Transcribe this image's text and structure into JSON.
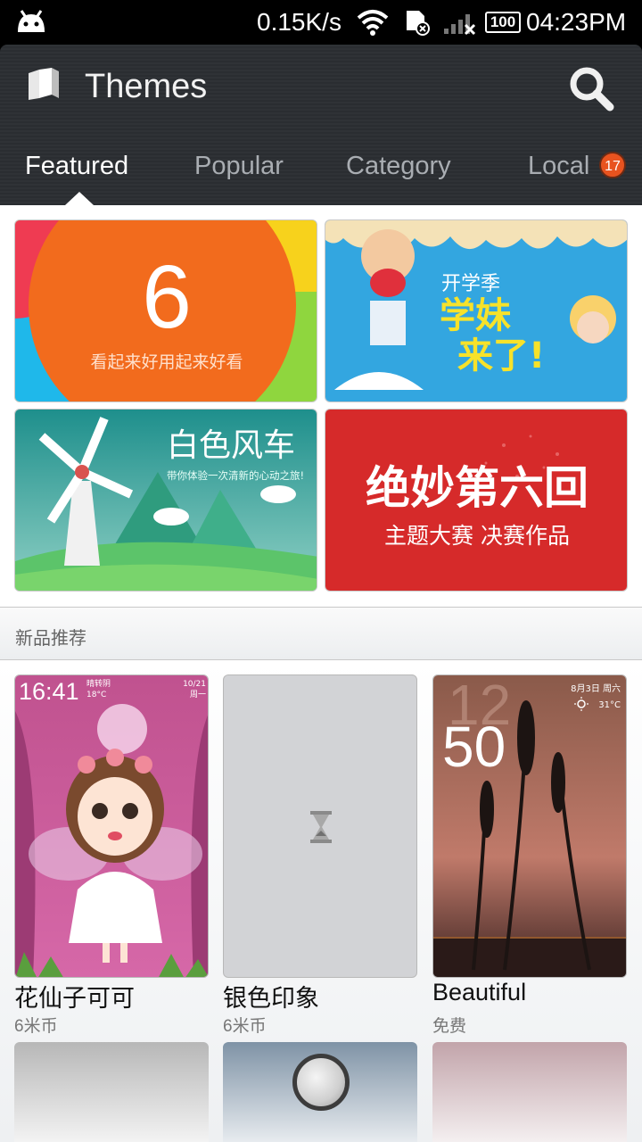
{
  "status_bar": {
    "network_speed": "0.15K/s",
    "battery": "100",
    "time": "04:23PM"
  },
  "header": {
    "title": "Themes",
    "search_icon": "search-icon",
    "app_icon": "themes-book-icon"
  },
  "tabs": [
    {
      "label": "Featured",
      "active": true
    },
    {
      "label": "Popular",
      "active": false
    },
    {
      "label": "Category",
      "active": false
    },
    {
      "label": "Local",
      "active": false,
      "badge": "17"
    }
  ],
  "banners": [
    {
      "big": "6",
      "caption": "看起来好用起来好看"
    },
    {
      "line1": "开学季",
      "line2": "学妹",
      "line3": "来了!"
    },
    {
      "title": "白色风车",
      "subtitle": "带你体验一次清新的心动之旅!"
    },
    {
      "title": "绝妙第六回",
      "subtitle": "主题大赛 决赛作品"
    }
  ],
  "section": {
    "label": "新品推荐"
  },
  "themes": [
    {
      "name": "花仙子可可",
      "price": "6米币",
      "lock_time": "16:41",
      "weather": "晴转阴",
      "temp": "18°C",
      "date": "10/21",
      "weekday": "周一"
    },
    {
      "name": "银色印象",
      "price": "6米币",
      "loading": true
    },
    {
      "name": "Beautiful",
      "price": "免费",
      "hour": "12",
      "minute": "50",
      "date": "8月3日 周六",
      "temp": "31°C"
    }
  ],
  "colors": {
    "header_bg": "#2d3034",
    "accent_orange": "#f26b1d",
    "badge": "#e8531f",
    "red_banner": "#d62a2a"
  }
}
